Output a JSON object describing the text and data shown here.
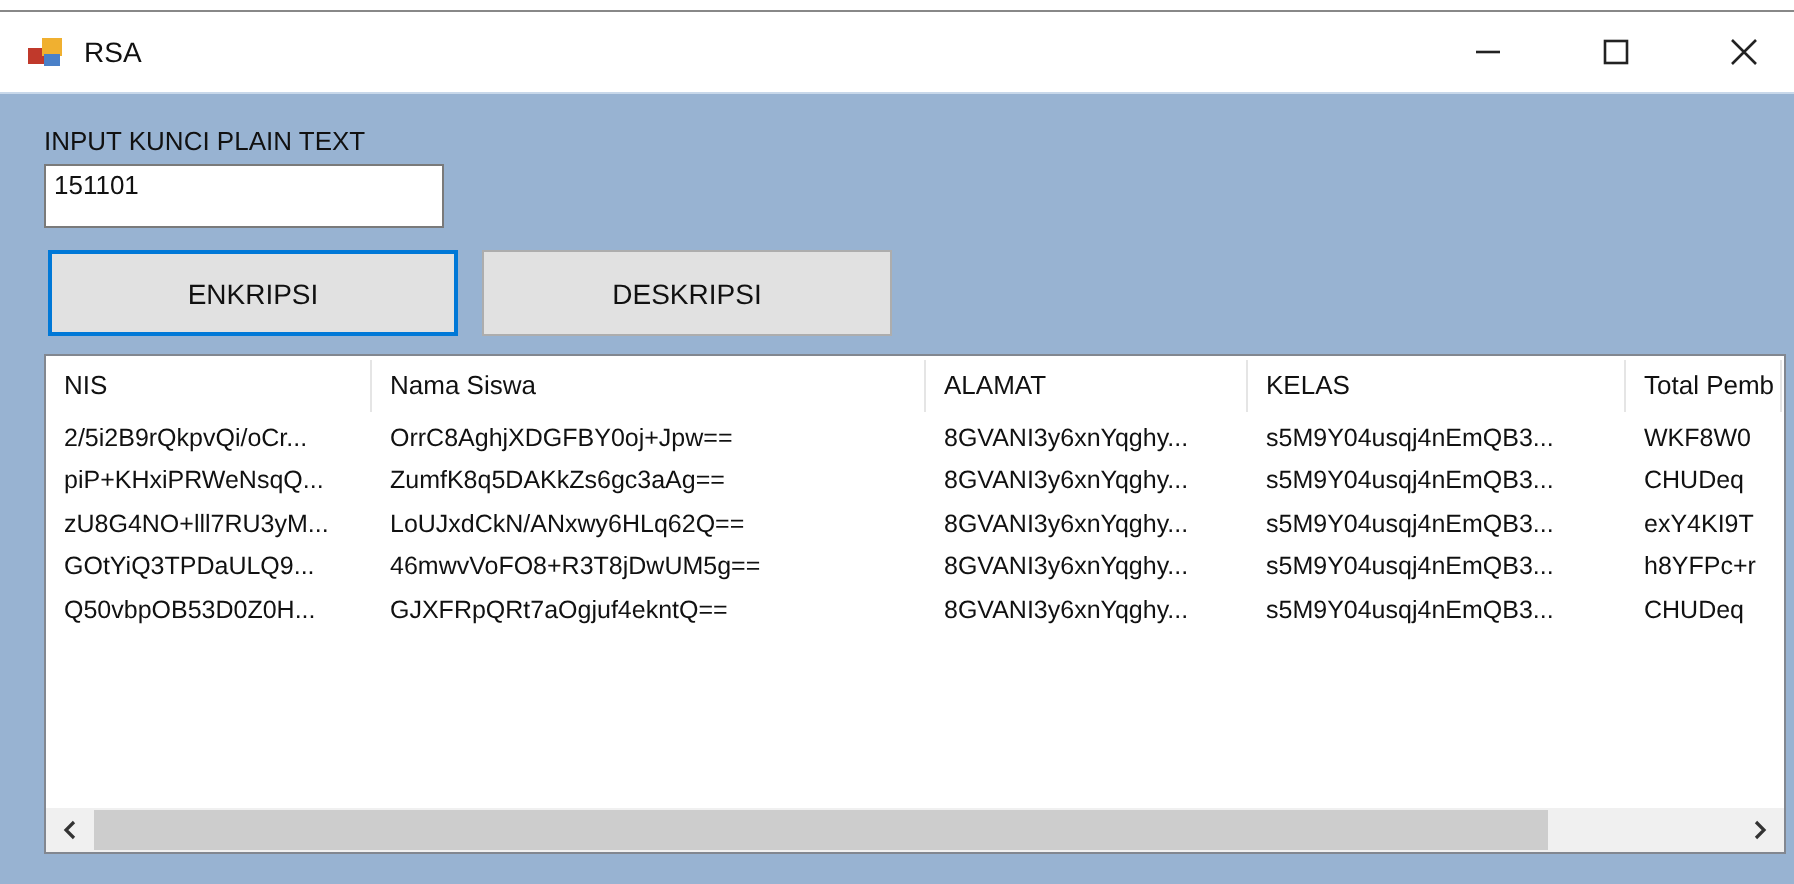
{
  "window": {
    "title": "RSA"
  },
  "input": {
    "label": "INPUT KUNCI PLAIN TEXT",
    "value": "151101"
  },
  "buttons": [
    {
      "label": "ENKRIPSI",
      "focused": true
    },
    {
      "label": "DESKRIPSI",
      "focused": false
    }
  ],
  "table": {
    "columns": [
      "NIS",
      "Nama Siswa",
      "ALAMAT",
      "KELAS",
      "Total Pemb"
    ],
    "rows": [
      [
        "2/5i2B9rQkpvQi/oCr...",
        "OrrC8AghjXDGFBY0oj+Jpw==",
        "8GVANI3y6xnYqghy...",
        "s5M9Y04usqj4nEmQB3...",
        "WKF8W0"
      ],
      [
        "piP+KHxiPRWeNsqQ...",
        "ZumfK8q5DAKkZs6gc3aAg==",
        "8GVANI3y6xnYqghy...",
        "s5M9Y04usqj4nEmQB3...",
        "CHUDeq"
      ],
      [
        "zU8G4NO+lll7RU3yM...",
        "LoUJxdCkN/ANxwy6HLq62Q==",
        "8GVANI3y6xnYqghy...",
        "s5M9Y04usqj4nEmQB3...",
        "exY4KI9T"
      ],
      [
        "GOtYiQ3TPDaULQ9...",
        "46mwvVoFO8+R3T8jDwUM5g==",
        "8GVANI3y6xnYqghy...",
        "s5M9Y04usqj4nEmQB3...",
        "h8YFPc+r"
      ],
      [
        "Q50vbpOB53D0Z0H...",
        "GJXFRpQRt7aOgjuf4ekntQ==",
        "8GVANI3y6xnYqghy...",
        "s5M9Y04usqj4nEmQB3...",
        "CHUDeq"
      ]
    ]
  }
}
